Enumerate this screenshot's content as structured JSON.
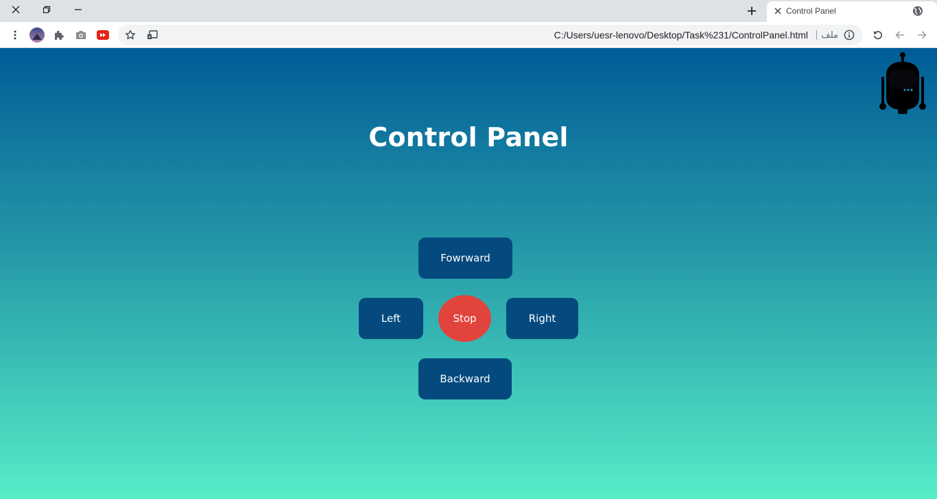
{
  "browser": {
    "tab": {
      "title": "Control Panel"
    },
    "address_bar": {
      "url": "C:/Users/uesr-lenovo/Desktop/Task%231/ControlPanel.html",
      "scheme_chip": "ملف"
    },
    "icons": {
      "window_close": "close-icon",
      "window_restore": "restore-icon",
      "window_minimize": "minimize-icon",
      "new_tab": "plus-icon",
      "tab_close": "close-icon",
      "tab_favicon": "globe-icon",
      "menu": "kebab-menu-icon",
      "profile": "avatar-icon",
      "extensions": "puzzle-icon",
      "screenshot": "camera-icon",
      "youtube": "youtube-icon",
      "bookmark": "star-icon",
      "cast": "cast-icon",
      "site_info": "info-icon",
      "reload": "reload-icon",
      "back": "arrow-left-icon",
      "forward": "arrow-right-icon"
    }
  },
  "page": {
    "title": "Control Panel",
    "controls": {
      "forward": "Fowrward",
      "left": "Left",
      "stop": "Stop",
      "right": "Right",
      "backward": "Backward"
    },
    "logo": "robot-icon"
  },
  "colors": {
    "gradient_top": "#005c97",
    "gradient_bottom": "#56edc7",
    "button_bg": "#044a7e",
    "stop_bg": "#e1443c",
    "title_text": "#ffffff"
  }
}
